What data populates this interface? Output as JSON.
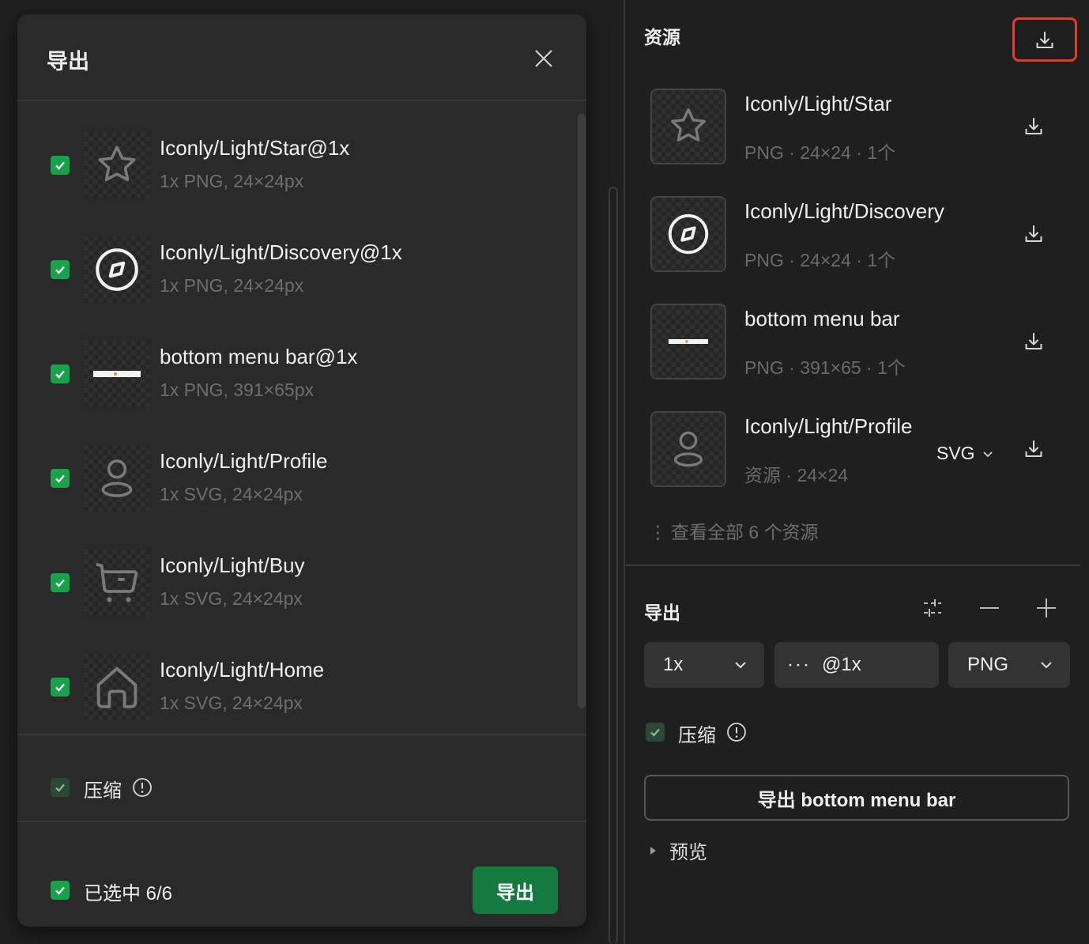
{
  "dialog": {
    "title": "导出",
    "items": [
      {
        "name": "Iconly/Light/Star@1x",
        "meta": "1x PNG, 24×24px",
        "icon": "star-icon",
        "checked": true
      },
      {
        "name": "Iconly/Light/Discovery@1x",
        "meta": "1x PNG, 24×24px",
        "icon": "compass-icon",
        "checked": true
      },
      {
        "name": "bottom menu bar@1x",
        "meta": "1x PNG, 391×65px",
        "icon": "menu-bar-thumbnail",
        "checked": true
      },
      {
        "name": "Iconly/Light/Profile",
        "meta": "1x SVG, 24×24px",
        "icon": "profile-icon",
        "checked": true
      },
      {
        "name": "Iconly/Light/Buy",
        "meta": "1x SVG, 24×24px",
        "icon": "cart-icon",
        "checked": true
      },
      {
        "name": "Iconly/Light/Home",
        "meta": "1x SVG, 24×24px",
        "icon": "home-icon",
        "checked": true
      }
    ],
    "compress_label": "压缩",
    "selected_label": "已选中 6/6",
    "export_button": "导出"
  },
  "panel": {
    "title": "资源",
    "assets": [
      {
        "name": "Iconly/Light/Star",
        "meta": "PNG · 24×24 · 1个",
        "icon": "star-icon"
      },
      {
        "name": "Iconly/Light/Discovery",
        "meta": "PNG · 24×24 · 1个",
        "icon": "compass-icon"
      },
      {
        "name": "bottom menu bar",
        "meta": "PNG · 391×65 · 1个",
        "icon": "menu-bar-thumbnail"
      },
      {
        "name": "Iconly/Light/Profile",
        "meta": "资源 · 24×24",
        "icon": "profile-icon",
        "format": "SVG"
      }
    ],
    "view_all": "查看全部 6 个资源",
    "export": {
      "title": "导出",
      "scale": "1x",
      "suffix_prefix": "···",
      "suffix": "@1x",
      "format": "PNG",
      "compress_label": "压缩",
      "export_button": "导出 bottom menu bar",
      "preview_label": "预览"
    }
  },
  "colors": {
    "background": "#1f1f1f",
    "dialog": "#2a2a2a",
    "accent_green": "#17a34a",
    "export_button": "#157a3f",
    "highlight_red": "#e23c2c"
  }
}
